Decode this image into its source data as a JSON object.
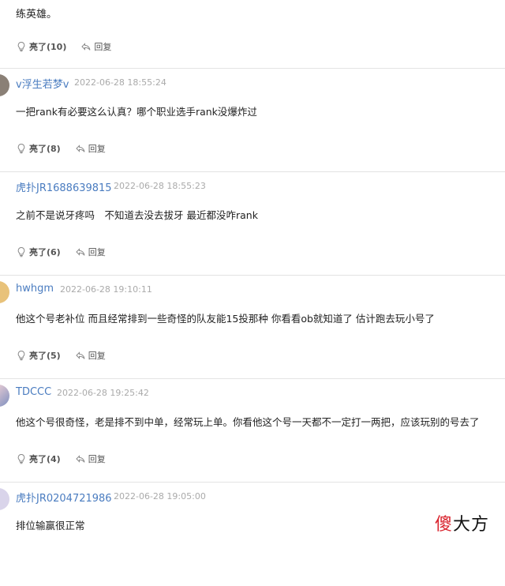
{
  "top": {
    "text": "练英雄。",
    "like_label": "亮了(10)",
    "reply_label": "回复"
  },
  "comments": [
    {
      "username": "v浮生若梦v",
      "time": "2022-06-28 18:55:24",
      "content": "一把rank有必要这么认真？哪个职业选手rank没爆炸过",
      "like_label": "亮了(8)",
      "reply_label": "回复"
    },
    {
      "username": "虎扑JR1688639815",
      "time": "2022-06-28 18:55:23",
      "content": "之前不是说牙疼吗　不知道去没去拔牙 最近都没咋rank",
      "like_label": "亮了(6)",
      "reply_label": "回复"
    },
    {
      "username": "hwhgm",
      "time": "2022-06-28 19:10:11",
      "content": "他这个号老补位 而且经常排到一些奇怪的队友能15投那种 你看看ob就知道了 估计跑去玩小号了",
      "like_label": "亮了(5)",
      "reply_label": "回复"
    },
    {
      "username": "TDCCC",
      "time": "2022-06-28 19:25:42",
      "content": "他这个号很奇怪，老是排不到中单，经常玩上单。你看他这个号一天都不一定打一两把，应该玩别的号去了",
      "like_label": "亮了(4)",
      "reply_label": "回复"
    },
    {
      "username": "虎扑JR0204721986",
      "time": "2022-06-28 19:05:00",
      "content": "排位输赢很正常",
      "like_label": "",
      "reply_label": ""
    }
  ],
  "watermark": {
    "part1": "傻",
    "part2": "大方"
  }
}
